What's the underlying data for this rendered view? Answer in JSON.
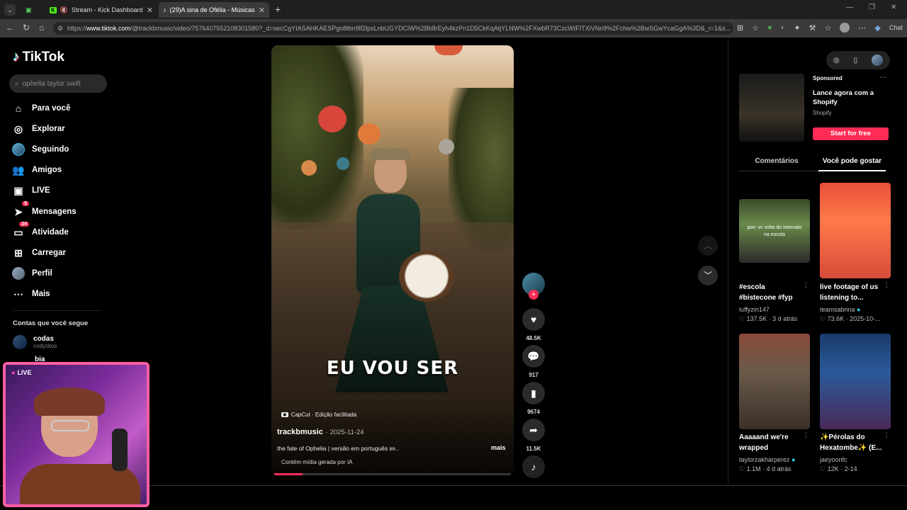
{
  "browser": {
    "tabs": [
      {
        "label": ""
      },
      {
        "label": "Stream - Kick Dashboard"
      },
      {
        "label": "(29)A sina de Ofélia - Músicas de"
      }
    ],
    "url_prefix": "https://",
    "url_domain": "www.tiktok.com",
    "url_rest": "/@trackbmusic/video/7576407552108301580?_d=secCgYIASAHKAESPgo8tbn9lf2lpxLnbUGYDCiW%2Bb8rEyh4kzPn1D5CkKqAtjYLNW%2FXwbR73CzcWtFITXiVNn9%2Fchw%2BwSGwYcaGgA%3D&_r=1&s...",
    "chat_label": "Chat"
  },
  "sidebar": {
    "logo": "TikTok",
    "search_placeholder": "ophelia taylor swift",
    "items": [
      {
        "label": "Para você",
        "icon": "home-icon"
      },
      {
        "label": "Explorar",
        "icon": "compass-icon"
      },
      {
        "label": "Seguindo",
        "icon": "following-avatar"
      },
      {
        "label": "Amigos",
        "icon": "friends-icon"
      },
      {
        "label": "LIVE",
        "icon": "live-icon"
      },
      {
        "label": "Mensagens",
        "icon": "messages-icon",
        "badge": "5"
      },
      {
        "label": "Atividade",
        "icon": "activity-icon",
        "badge": "24"
      },
      {
        "label": "Carregar",
        "icon": "upload-icon"
      },
      {
        "label": "Perfil",
        "icon": "profile-avatar"
      },
      {
        "label": "Mais",
        "icon": "more-icon"
      }
    ],
    "following_header": "Contas que você segue",
    "following": [
      {
        "name": "codas",
        "handle": "codyzitos"
      },
      {
        "name": "bia",
        "handle": ""
      }
    ]
  },
  "video": {
    "overlay_text": "EU VOU SER",
    "capcut": "CapCut · Edição facilitada",
    "author": "trackbmusic",
    "date": "· 2025-11-24",
    "caption": "the fate of Ophelia | versão em português",
    "caption_more": "mais",
    "ai_label": "Contém mídia gerada por IA",
    "likes": "48.5K",
    "comments": "917",
    "saves": "9674",
    "shares": "11.5K"
  },
  "right": {
    "sponsored": "Sponsored",
    "ad_title": "Lance agora com a Shopify",
    "ad_brand": "Shopify",
    "ad_cta": "Start for free",
    "tab_comments": "Comentários",
    "tab_suggest": "Você pode gostar",
    "cards": [
      {
        "title": "#escola #bistecone #fyp",
        "user": "luffyzin147",
        "stats": "137.5K · 3 d atrás",
        "thumb_text": "pov: vc volta do intervalo na escola"
      },
      {
        "title": "live footage of us listening to...",
        "user": "teamsabrina",
        "stats": "73.6K · 2025-10-...",
        "thumb_text": ""
      },
      {
        "title": "Aaaaand we're wrapped",
        "user": "taylorzakharperez",
        "stats": "1.1M · 4 d atrás",
        "thumb_text": ""
      },
      {
        "title": "✨Pérolas do Hexatombe✨ (E...",
        "user": "jaeyoonfc",
        "stats": "12K · 2-14",
        "thumb_text": ""
      }
    ]
  },
  "cam": {
    "live_label": "LIVE"
  },
  "colors": {
    "accent": "#fe2c55",
    "cam_border": "#ff5fa2",
    "bg": "#000000"
  }
}
